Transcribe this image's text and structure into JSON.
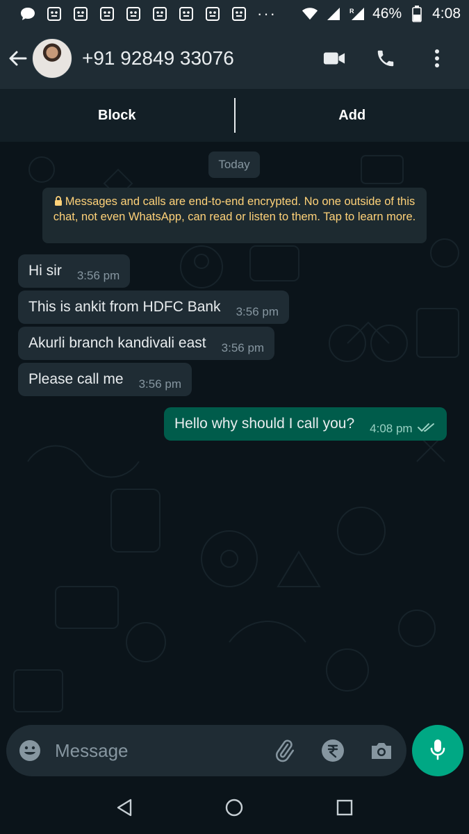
{
  "status_bar": {
    "battery": "46%",
    "time": "4:08",
    "overflow": "···",
    "icons": [
      "chat-bubble-icon",
      "emoji-icon",
      "emoji-icon",
      "emoji-icon",
      "emoji-icon",
      "emoji-icon",
      "emoji-icon",
      "emoji-icon",
      "emoji-icon",
      "wifi-icon",
      "signal-icon",
      "roaming-signal-icon",
      "battery-icon"
    ]
  },
  "header": {
    "contact": "+91 92849 33076",
    "icons": [
      "back-arrow-icon",
      "video-call-icon",
      "phone-icon",
      "more-vert-icon"
    ]
  },
  "action_bar": {
    "block_label": "Block",
    "add_label": "Add"
  },
  "chat": {
    "date_chip": "Today",
    "encryption_notice": "Messages and calls are end-to-end encrypted. No one outside of this chat, not even WhatsApp, can read or listen to them. Tap to learn more.",
    "messages": [
      {
        "direction": "in",
        "text": "Hi sir",
        "time": "3:56 pm"
      },
      {
        "direction": "in",
        "text": "This is ankit from HDFC Bank",
        "time": "3:56 pm"
      },
      {
        "direction": "in",
        "text": "Akurli branch kandivali east",
        "time": "3:56 pm"
      },
      {
        "direction": "in",
        "text": "Please call me",
        "time": "3:56 pm"
      },
      {
        "direction": "out",
        "text": "Hello why should I call you?",
        "time": "4:08 pm",
        "status": "delivered"
      }
    ]
  },
  "composer": {
    "placeholder": "Message",
    "icons": [
      "emoji-icon",
      "attach-icon",
      "rupee-payment-icon",
      "camera-icon",
      "mic-icon"
    ]
  },
  "colors": {
    "background": "#0b141a",
    "bar": "#1f2c34",
    "incoming_bubble": "#1f2c34",
    "outgoing_bubble": "#005c4b",
    "accent": "#00a884",
    "encryption_text": "#ffd279"
  }
}
